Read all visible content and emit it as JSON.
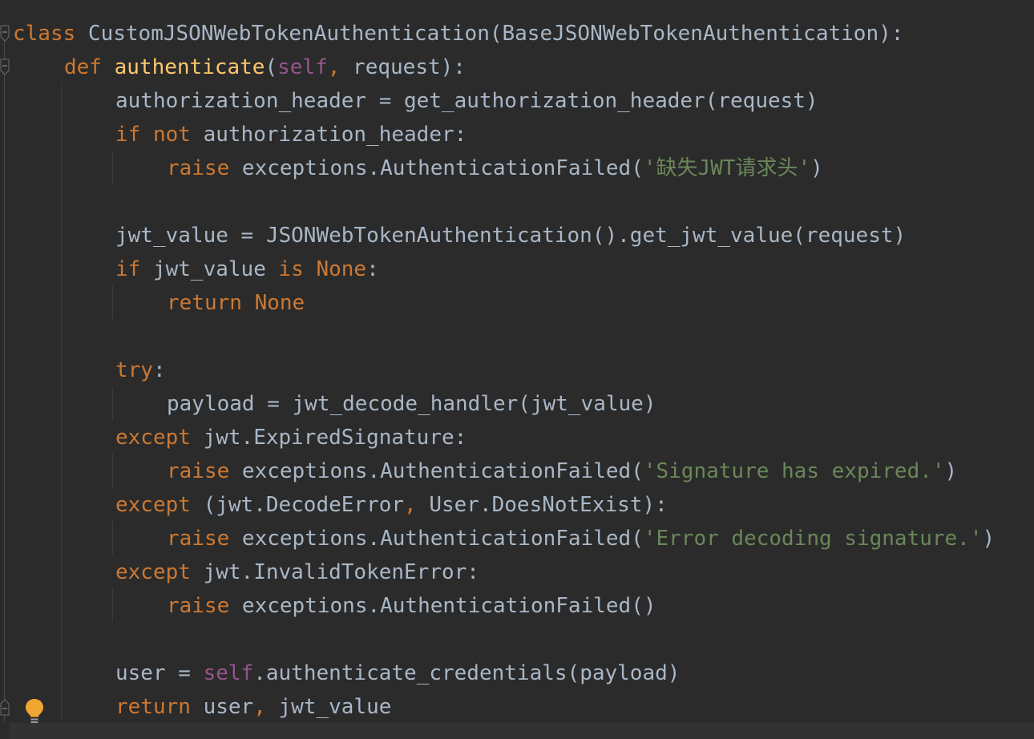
{
  "editor": {
    "lines": [
      {
        "indent": 0,
        "tokens": [
          {
            "t": "class",
            "c": "kw"
          },
          {
            "t": " CustomJSONWebTokenAuthentication(BaseJSONWebTokenAuthentication):",
            "c": "plain"
          }
        ]
      },
      {
        "indent": 1,
        "tokens": [
          {
            "t": "def",
            "c": "kw"
          },
          {
            "t": " ",
            "c": "plain"
          },
          {
            "t": "authenticate",
            "c": "fn"
          },
          {
            "t": "(",
            "c": "plain"
          },
          {
            "t": "self",
            "c": "self"
          },
          {
            "t": ",",
            "c": "kw"
          },
          {
            "t": " request):",
            "c": "plain"
          }
        ]
      },
      {
        "indent": 2,
        "tokens": [
          {
            "t": "authorization_header = get_authorization_header(request)",
            "c": "plain"
          }
        ]
      },
      {
        "indent": 2,
        "tokens": [
          {
            "t": "if not",
            "c": "kw"
          },
          {
            "t": " authorization_header:",
            "c": "plain"
          }
        ]
      },
      {
        "indent": 3,
        "tokens": [
          {
            "t": "raise",
            "c": "kw"
          },
          {
            "t": " exceptions.AuthenticationFailed(",
            "c": "plain"
          },
          {
            "t": "'缺失JWT请求头'",
            "c": "str"
          },
          {
            "t": ")",
            "c": "plain"
          }
        ]
      },
      {
        "indent": 0,
        "tokens": []
      },
      {
        "indent": 2,
        "tokens": [
          {
            "t": "jwt_value = JSONWebTokenAuthentication().get_jwt_value(request)",
            "c": "plain"
          }
        ]
      },
      {
        "indent": 2,
        "tokens": [
          {
            "t": "if",
            "c": "kw"
          },
          {
            "t": " jwt_value ",
            "c": "plain"
          },
          {
            "t": "is None",
            "c": "kw"
          },
          {
            "t": ":",
            "c": "plain"
          }
        ]
      },
      {
        "indent": 3,
        "tokens": [
          {
            "t": "return None",
            "c": "kw"
          }
        ]
      },
      {
        "indent": 0,
        "tokens": []
      },
      {
        "indent": 2,
        "tokens": [
          {
            "t": "try",
            "c": "kw"
          },
          {
            "t": ":",
            "c": "plain"
          }
        ]
      },
      {
        "indent": 3,
        "tokens": [
          {
            "t": "payload = jwt_decode_handler(jwt_value)",
            "c": "plain"
          }
        ]
      },
      {
        "indent": 2,
        "tokens": [
          {
            "t": "except",
            "c": "kw"
          },
          {
            "t": " jwt.ExpiredSignature:",
            "c": "plain"
          }
        ]
      },
      {
        "indent": 3,
        "tokens": [
          {
            "t": "raise",
            "c": "kw"
          },
          {
            "t": " exceptions.AuthenticationFailed(",
            "c": "plain"
          },
          {
            "t": "'Signature has expired.'",
            "c": "str"
          },
          {
            "t": ")",
            "c": "plain"
          }
        ]
      },
      {
        "indent": 2,
        "tokens": [
          {
            "t": "except",
            "c": "kw"
          },
          {
            "t": " (jwt.DecodeError",
            "c": "plain"
          },
          {
            "t": ",",
            "c": "kw"
          },
          {
            "t": " User.DoesNotExist):",
            "c": "plain"
          }
        ]
      },
      {
        "indent": 3,
        "tokens": [
          {
            "t": "raise",
            "c": "kw"
          },
          {
            "t": " exceptions.AuthenticationFailed(",
            "c": "plain"
          },
          {
            "t": "'Error decoding signature.'",
            "c": "str"
          },
          {
            "t": ")",
            "c": "plain"
          }
        ]
      },
      {
        "indent": 2,
        "tokens": [
          {
            "t": "except",
            "c": "kw"
          },
          {
            "t": " jwt.InvalidTokenError:",
            "c": "plain"
          }
        ]
      },
      {
        "indent": 3,
        "tokens": [
          {
            "t": "raise",
            "c": "kw"
          },
          {
            "t": " exceptions.AuthenticationFailed()",
            "c": "plain"
          }
        ]
      },
      {
        "indent": 0,
        "tokens": []
      },
      {
        "indent": 2,
        "tokens": [
          {
            "t": "user = ",
            "c": "plain"
          },
          {
            "t": "self",
            "c": "self"
          },
          {
            "t": ".authenticate_credentials(payload)",
            "c": "plain"
          }
        ]
      },
      {
        "indent": 2,
        "tokens": [
          {
            "t": "return",
            "c": "kw"
          },
          {
            "t": " user",
            "c": "plain"
          },
          {
            "t": ",",
            "c": "kw"
          },
          {
            "t": " jwt_value",
            "c": "plain"
          }
        ]
      }
    ]
  },
  "icons": {
    "fold": "fold-marker-icon",
    "intention": "lightbulb-icon"
  },
  "colors": {
    "background": "#2b2b2b",
    "text": "#a9b7c6",
    "keyword": "#cc7832",
    "function": "#ffc66d",
    "self": "#94558d",
    "string": "#6a8759",
    "bulb": "#f0a732"
  }
}
